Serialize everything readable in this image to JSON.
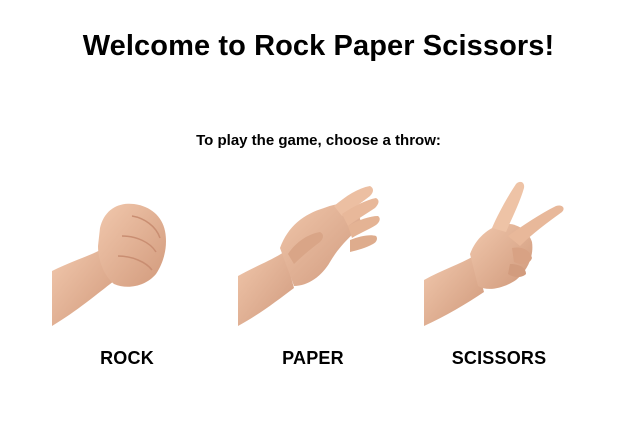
{
  "page": {
    "title": "Welcome to Rock Paper Scissors!",
    "instruction": "To play the game, choose a throw:"
  },
  "choices": [
    {
      "label": "ROCK",
      "icon": "rock-fist-icon"
    },
    {
      "label": "PAPER",
      "icon": "paper-hand-icon"
    },
    {
      "label": "SCISSORS",
      "icon": "scissors-hand-icon"
    }
  ],
  "colors": {
    "background": "#ffffff",
    "text": "#000000",
    "skin": "#e8b89a",
    "skin_shadow": "#c98e72"
  }
}
